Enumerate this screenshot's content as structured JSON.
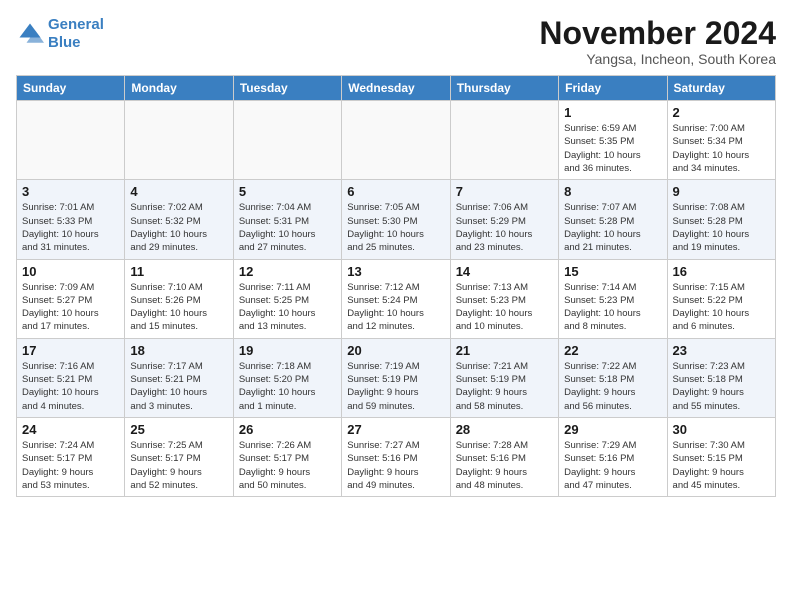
{
  "header": {
    "logo_line1": "General",
    "logo_line2": "Blue",
    "month_title": "November 2024",
    "subtitle": "Yangsa, Incheon, South Korea"
  },
  "weekdays": [
    "Sunday",
    "Monday",
    "Tuesday",
    "Wednesday",
    "Thursday",
    "Friday",
    "Saturday"
  ],
  "weeks": [
    [
      {
        "day": "",
        "info": ""
      },
      {
        "day": "",
        "info": ""
      },
      {
        "day": "",
        "info": ""
      },
      {
        "day": "",
        "info": ""
      },
      {
        "day": "",
        "info": ""
      },
      {
        "day": "1",
        "info": "Sunrise: 6:59 AM\nSunset: 5:35 PM\nDaylight: 10 hours\nand 36 minutes."
      },
      {
        "day": "2",
        "info": "Sunrise: 7:00 AM\nSunset: 5:34 PM\nDaylight: 10 hours\nand 34 minutes."
      }
    ],
    [
      {
        "day": "3",
        "info": "Sunrise: 7:01 AM\nSunset: 5:33 PM\nDaylight: 10 hours\nand 31 minutes."
      },
      {
        "day": "4",
        "info": "Sunrise: 7:02 AM\nSunset: 5:32 PM\nDaylight: 10 hours\nand 29 minutes."
      },
      {
        "day": "5",
        "info": "Sunrise: 7:04 AM\nSunset: 5:31 PM\nDaylight: 10 hours\nand 27 minutes."
      },
      {
        "day": "6",
        "info": "Sunrise: 7:05 AM\nSunset: 5:30 PM\nDaylight: 10 hours\nand 25 minutes."
      },
      {
        "day": "7",
        "info": "Sunrise: 7:06 AM\nSunset: 5:29 PM\nDaylight: 10 hours\nand 23 minutes."
      },
      {
        "day": "8",
        "info": "Sunrise: 7:07 AM\nSunset: 5:28 PM\nDaylight: 10 hours\nand 21 minutes."
      },
      {
        "day": "9",
        "info": "Sunrise: 7:08 AM\nSunset: 5:28 PM\nDaylight: 10 hours\nand 19 minutes."
      }
    ],
    [
      {
        "day": "10",
        "info": "Sunrise: 7:09 AM\nSunset: 5:27 PM\nDaylight: 10 hours\nand 17 minutes."
      },
      {
        "day": "11",
        "info": "Sunrise: 7:10 AM\nSunset: 5:26 PM\nDaylight: 10 hours\nand 15 minutes."
      },
      {
        "day": "12",
        "info": "Sunrise: 7:11 AM\nSunset: 5:25 PM\nDaylight: 10 hours\nand 13 minutes."
      },
      {
        "day": "13",
        "info": "Sunrise: 7:12 AM\nSunset: 5:24 PM\nDaylight: 10 hours\nand 12 minutes."
      },
      {
        "day": "14",
        "info": "Sunrise: 7:13 AM\nSunset: 5:23 PM\nDaylight: 10 hours\nand 10 minutes."
      },
      {
        "day": "15",
        "info": "Sunrise: 7:14 AM\nSunset: 5:23 PM\nDaylight: 10 hours\nand 8 minutes."
      },
      {
        "day": "16",
        "info": "Sunrise: 7:15 AM\nSunset: 5:22 PM\nDaylight: 10 hours\nand 6 minutes."
      }
    ],
    [
      {
        "day": "17",
        "info": "Sunrise: 7:16 AM\nSunset: 5:21 PM\nDaylight: 10 hours\nand 4 minutes."
      },
      {
        "day": "18",
        "info": "Sunrise: 7:17 AM\nSunset: 5:21 PM\nDaylight: 10 hours\nand 3 minutes."
      },
      {
        "day": "19",
        "info": "Sunrise: 7:18 AM\nSunset: 5:20 PM\nDaylight: 10 hours\nand 1 minute."
      },
      {
        "day": "20",
        "info": "Sunrise: 7:19 AM\nSunset: 5:19 PM\nDaylight: 9 hours\nand 59 minutes."
      },
      {
        "day": "21",
        "info": "Sunrise: 7:21 AM\nSunset: 5:19 PM\nDaylight: 9 hours\nand 58 minutes."
      },
      {
        "day": "22",
        "info": "Sunrise: 7:22 AM\nSunset: 5:18 PM\nDaylight: 9 hours\nand 56 minutes."
      },
      {
        "day": "23",
        "info": "Sunrise: 7:23 AM\nSunset: 5:18 PM\nDaylight: 9 hours\nand 55 minutes."
      }
    ],
    [
      {
        "day": "24",
        "info": "Sunrise: 7:24 AM\nSunset: 5:17 PM\nDaylight: 9 hours\nand 53 minutes."
      },
      {
        "day": "25",
        "info": "Sunrise: 7:25 AM\nSunset: 5:17 PM\nDaylight: 9 hours\nand 52 minutes."
      },
      {
        "day": "26",
        "info": "Sunrise: 7:26 AM\nSunset: 5:17 PM\nDaylight: 9 hours\nand 50 minutes."
      },
      {
        "day": "27",
        "info": "Sunrise: 7:27 AM\nSunset: 5:16 PM\nDaylight: 9 hours\nand 49 minutes."
      },
      {
        "day": "28",
        "info": "Sunrise: 7:28 AM\nSunset: 5:16 PM\nDaylight: 9 hours\nand 48 minutes."
      },
      {
        "day": "29",
        "info": "Sunrise: 7:29 AM\nSunset: 5:16 PM\nDaylight: 9 hours\nand 47 minutes."
      },
      {
        "day": "30",
        "info": "Sunrise: 7:30 AM\nSunset: 5:15 PM\nDaylight: 9 hours\nand 45 minutes."
      }
    ]
  ]
}
